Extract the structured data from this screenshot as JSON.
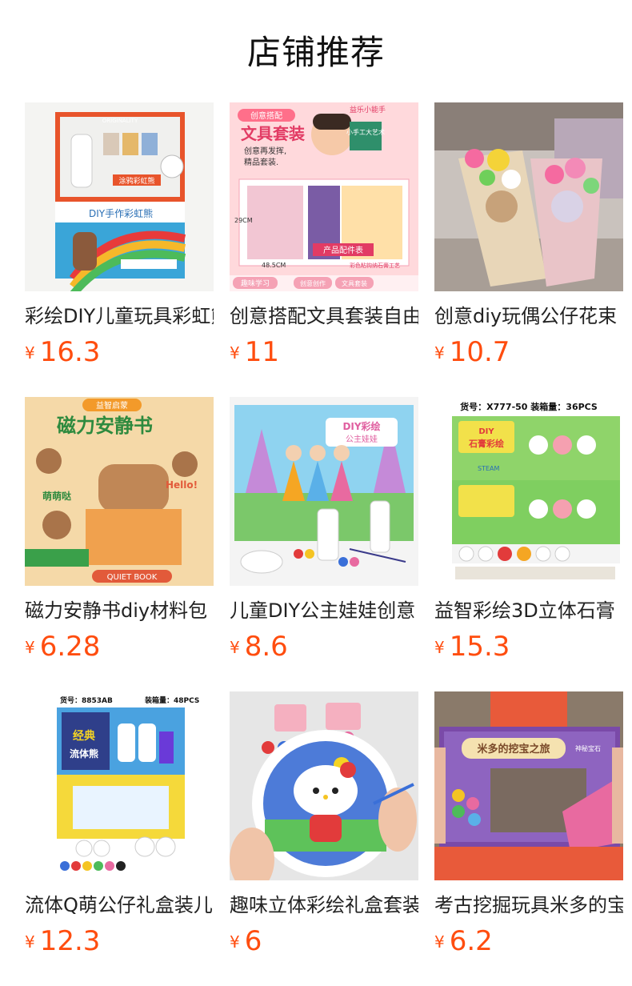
{
  "header": {
    "title": "店铺推荐"
  },
  "theme": {
    "price_color": "#ff4d0f",
    "text_color": "#222222"
  },
  "products": [
    {
      "name": "彩绘DIY儿童玩具彩虹熊",
      "currency": "¥",
      "price": "16.3",
      "image_icon": "rainbow-bear-kit-image",
      "image_text": [
        "ORIGINALITY",
        "涂鸦彩虹熊",
        "DIY手作彩虹熊"
      ]
    },
    {
      "name": "创意搭配文具套装自由",
      "currency": "¥",
      "price": "11",
      "image_icon": "stationery-set-image",
      "image_text": [
        "创意搭配",
        "文具套装",
        "创意再发挥,",
        "精品套装.",
        "益乐小能手",
        "小手工大艺术",
        "产品配件表",
        "趣味学习",
        "创意创作",
        "文具套装",
        "48.5CM",
        "29CM",
        "彩色粘钩纳石膏工艺"
      ]
    },
    {
      "name": "创意diy玩偶公仔花束",
      "currency": "¥",
      "price": "10.7",
      "image_icon": "flower-bouquet-image",
      "image_text": []
    },
    {
      "name": "磁力安静书diy材料包",
      "currency": "¥",
      "price": "6.28",
      "image_icon": "quiet-book-image",
      "image_text": [
        "磁力安静书",
        "益智启蒙",
        "萌萌哒",
        "Hello!",
        "QUIET BOOK"
      ]
    },
    {
      "name": "儿童DIY公主娃娃创意",
      "currency": "¥",
      "price": "8.6",
      "image_icon": "princess-painting-image",
      "image_text": [
        "DIY彩绘",
        "公主娃娃"
      ]
    },
    {
      "name": "益智彩绘3D立体石膏",
      "currency": "¥",
      "price": "15.3",
      "image_icon": "plaster-painting-image",
      "image_text": [
        "货号：X777-50  装箱量：36PCS",
        "DIY",
        "石膏彩绘",
        "STEAM"
      ]
    },
    {
      "name": "流体Q萌公仔礼盒装儿",
      "currency": "¥",
      "price": "12.3",
      "image_icon": "fluid-bear-gift-box-image",
      "image_text": [
        "货号：8853AB",
        "装箱量：48PCS",
        "经典",
        "流体熊"
      ]
    },
    {
      "name": "趣味立体彩绘礼盒套装",
      "currency": "¥",
      "price": "6",
      "image_icon": "hello-kitty-plate-image",
      "image_text": []
    },
    {
      "name": "考古挖掘玩具米多的宝",
      "currency": "¥",
      "price": "6.2",
      "image_icon": "archaeology-dig-toy-image",
      "image_text": [
        "米多的挖宝之旅",
        "神秘宝石"
      ]
    }
  ]
}
